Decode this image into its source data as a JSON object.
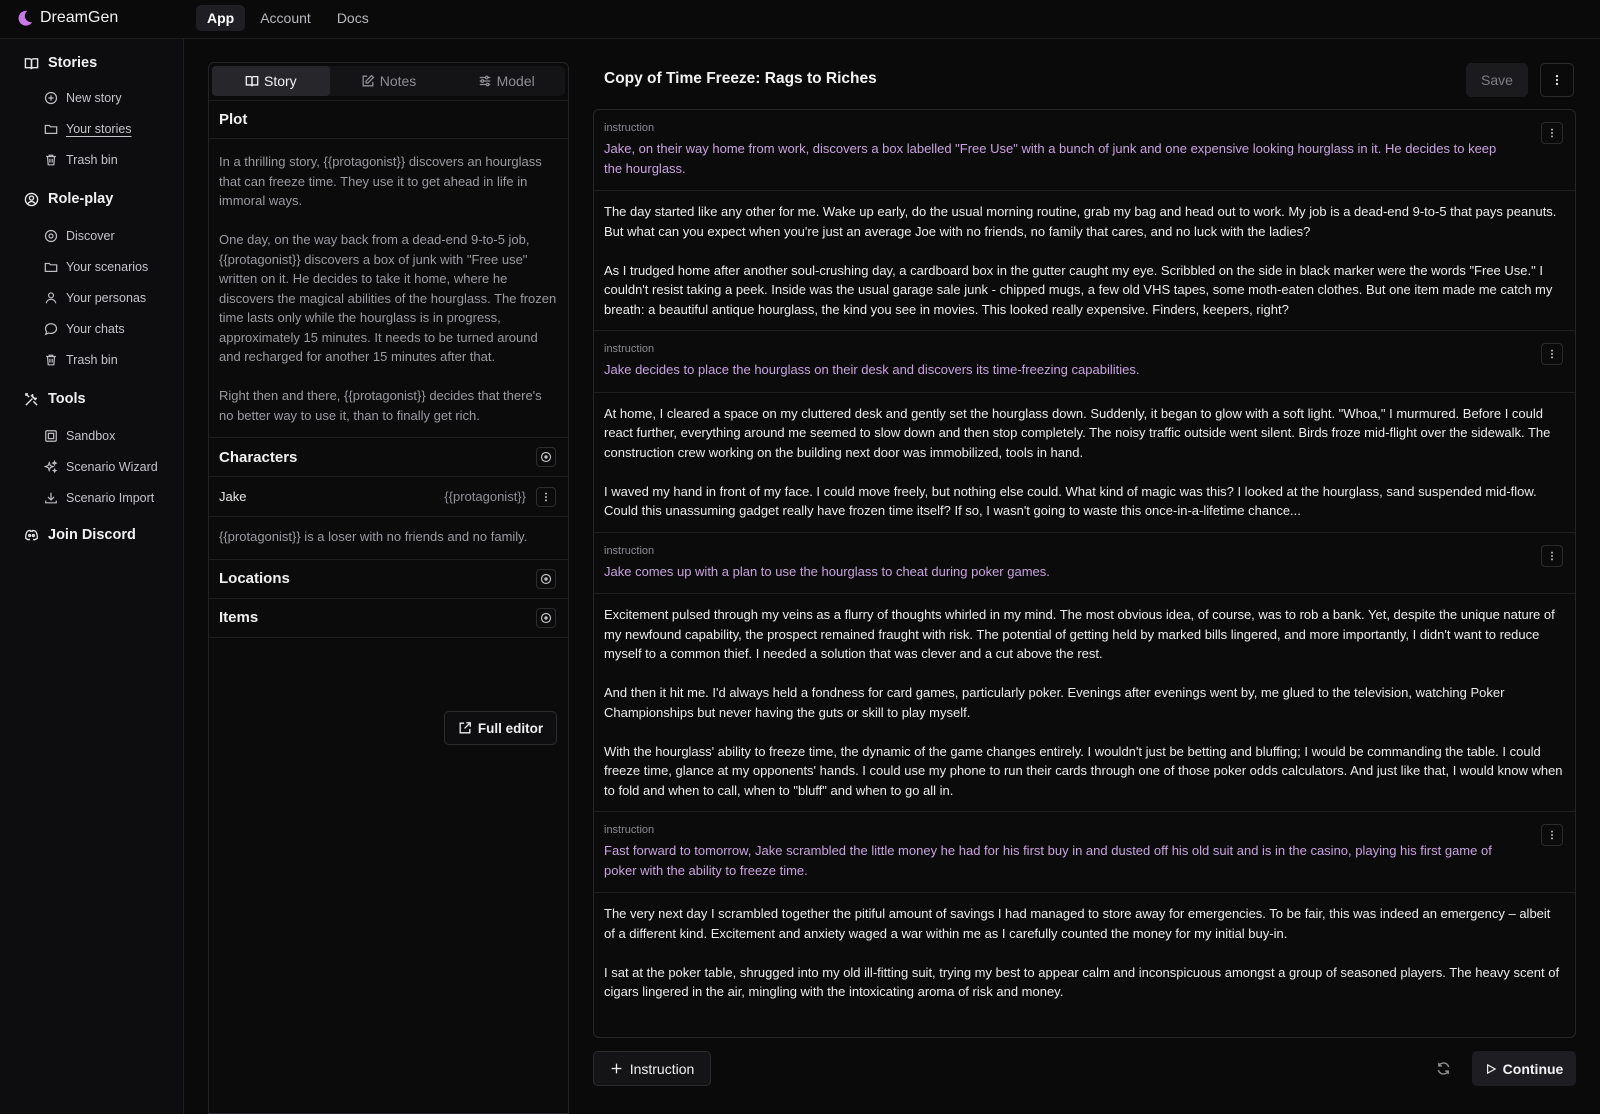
{
  "app": {
    "name": "DreamGen"
  },
  "topnav": [
    {
      "label": "App",
      "active": true
    },
    {
      "label": "Account",
      "active": false
    },
    {
      "label": "Docs",
      "active": false
    }
  ],
  "sidebar": {
    "stories": {
      "label": "Stories",
      "items": [
        "New story",
        "Your stories",
        "Trash bin"
      ]
    },
    "roleplay": {
      "label": "Role-play",
      "items": [
        "Discover",
        "Your scenarios",
        "Your personas",
        "Your chats",
        "Trash bin"
      ]
    },
    "tools": {
      "label": "Tools",
      "items": [
        "Sandbox",
        "Scenario Wizard",
        "Scenario Import"
      ]
    },
    "discord": {
      "label": "Join Discord"
    }
  },
  "left_panel": {
    "tabs": [
      "Story",
      "Notes",
      "Model"
    ],
    "plot": {
      "heading": "Plot",
      "paragraphs": [
        "In a thrilling story, {{protagonist}} discovers an hourglass that can freeze time. They use it to get ahead in life in immoral ways.",
        "One day, on the way back from a dead-end 9-to-5 job, {{protagonist}} discovers a box of junk with \"Free use\" written on it. He decides to take it home, where he discovers the magical abilities of the hourglass. The frozen time lasts only while the hourglass is in progress, approximately 15 minutes. It needs to be turned around and recharged for another 15 minutes after that.",
        "Right then and there, {{protagonist}} decides that there's no better way to use it, than to finally get rich."
      ]
    },
    "characters": {
      "heading": "Characters",
      "items": [
        {
          "name": "Jake",
          "variable": "{{protagonist}}",
          "description": "{{protagonist}} is a loser with no friends and no family."
        }
      ]
    },
    "locations": {
      "heading": "Locations"
    },
    "items": {
      "heading": "Items"
    },
    "full_editor_label": "Full editor"
  },
  "main": {
    "title": "Copy of Time Freeze: Rags to Riches",
    "save_label": "Save",
    "instruction_label": "instruction",
    "blocks": [
      {
        "type": "instruction",
        "text": "Jake, on their way home from work, discovers a box labelled \"Free Use\" with a bunch of junk and one expensive looking hourglass in it. He decides to keep the hourglass."
      },
      {
        "type": "prose",
        "paragraphs": [
          "The day started like any other for me. Wake up early, do the usual morning routine, grab my bag and head out to work. My job is a dead-end 9-to-5 that pays peanuts. But what can you expect when you're just an average Joe with no friends, no family that cares, and no luck with the ladies?",
          "As I trudged home after another soul-crushing day, a cardboard box in the gutter caught my eye. Scribbled on the side in black marker were the words \"Free Use.\" I couldn't resist taking a peek. Inside was the usual garage sale junk - chipped mugs, a few old VHS tapes, some moth-eaten clothes. But one item made me catch my breath: a beautiful antique hourglass, the kind you see in movies. This looked really expensive. Finders, keepers, right?"
        ]
      },
      {
        "type": "instruction",
        "text": "Jake decides to place the hourglass on their desk and discovers its time-freezing capabilities."
      },
      {
        "type": "prose",
        "paragraphs": [
          "At home, I cleared a space on my cluttered desk and gently set the hourglass down. Suddenly, it began to glow with a soft light. \"Whoa,\" I murmured. Before I could react further, everything around me seemed to slow down and then stop completely. The noisy traffic outside went silent. Birds froze mid-flight over the sidewalk. The construction crew working on the building next door was immobilized, tools in hand.",
          "I waved my hand in front of my face. I could move freely, but nothing else could. What kind of magic was this? I looked at the hourglass, sand suspended mid-flow. Could this unassuming gadget really have frozen time itself? If so, I wasn't going to waste this once-in-a-lifetime chance..."
        ]
      },
      {
        "type": "instruction",
        "text": "Jake comes up with a plan to use the hourglass to cheat during poker games."
      },
      {
        "type": "prose",
        "paragraphs": [
          "Excitement pulsed through my veins as a flurry of thoughts whirled in my mind. The most obvious idea, of course, was to rob a bank. Yet, despite the unique nature of my newfound capability, the prospect remained fraught with risk. The potential of getting held by marked bills lingered, and more importantly, I didn't want to reduce myself to a common thief.  I needed a solution that was clever and a cut above the rest.",
          "And then it hit me. I'd always held a fondness for card games, particularly poker. Evenings after evenings went by, me glued to the television, watching Poker Championships but never having the guts or skill to play myself.",
          "With the hourglass' ability to freeze time, the dynamic of the game changes entirely. I wouldn't just be betting and bluffing; I would be commanding the table. I could freeze time, glance at my opponents' hands. I could use my phone to run their cards through one of those poker odds calculators. And just like that, I would know when to fold and when to call, when to \"bluff\" and when to go all in."
        ]
      },
      {
        "type": "instruction",
        "text": "Fast forward to tomorrow, Jake scrambled the little money he had for his first buy in and dusted off his old suit and is in the casino, playing his first game of poker with the ability to freeze time."
      },
      {
        "type": "prose",
        "paragraphs": [
          "The very next day I scrambled together the pitiful amount of savings I had managed to store away for emergencies. To be fair, this was indeed an emergency – albeit of a different kind. Excitement and anxiety waged a war within me as I carefully counted the money for my initial buy-in.",
          "I sat at the poker table, shrugged into my old ill-fitting suit, trying my best to appear calm and inconspicuous amongst a group of seasoned players. The heavy scent of cigars lingered in the air, mingling with the intoxicating aroma of risk and money."
        ]
      }
    ],
    "add_instruction_label": "Instruction",
    "continue_label": "Continue"
  }
}
